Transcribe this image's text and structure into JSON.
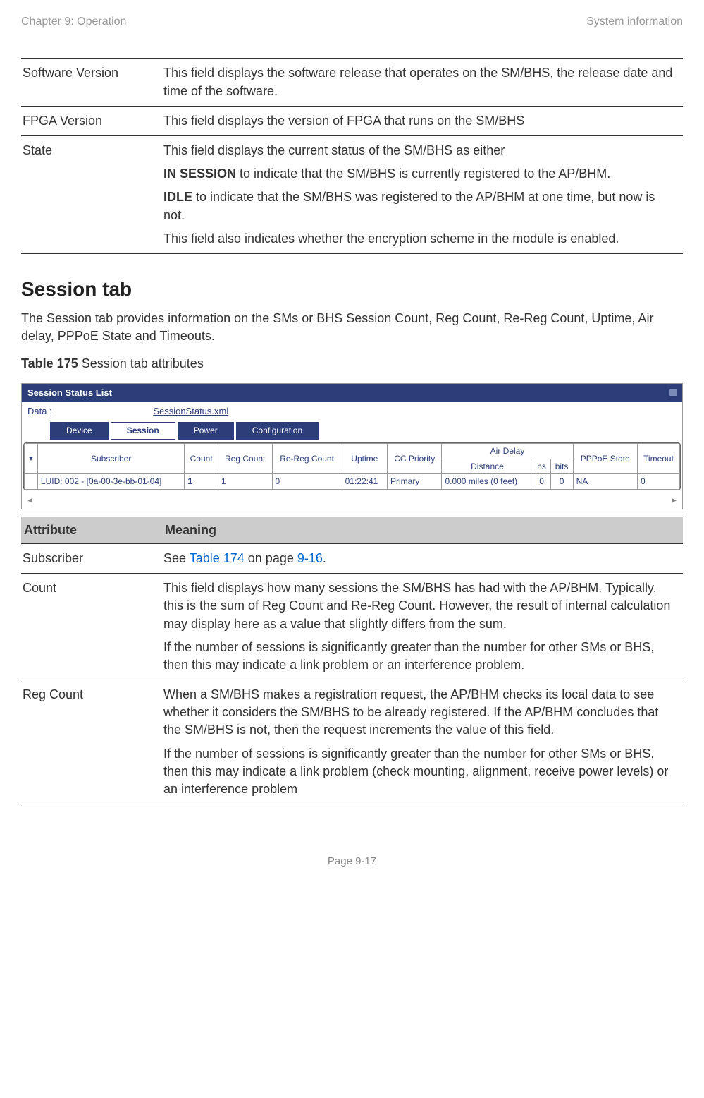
{
  "header": {
    "left": "Chapter 9:  Operation",
    "right": "System information"
  },
  "top_table": [
    {
      "attr": "Software Version",
      "desc": "This field displays the software release that operates on the SM/BHS, the release date and time of the software."
    },
    {
      "attr": "FPGA Version",
      "desc": "This field displays the version of FPGA that runs on the SM/BHS"
    },
    {
      "attr": "State",
      "desc_pre": "This field displays the current status of the SM/BHS as either",
      "in_session": "IN SESSION",
      "in_session_rest": " to indicate that the SM/BHS is currently registered to the AP/BHM.",
      "idle": "IDLE",
      "idle_rest": " to indicate that the SM/BHS was registered to the AP/BHM at one time, but now is not.",
      "last": "This field also indicates whether the encryption scheme in the module is enabled."
    }
  ],
  "h2": "Session tab",
  "h2_para": "The Session tab provides information on the SMs or BHS Session Count, Reg Count, Re-Reg Count, Uptime, Air delay, PPPoE State and Timeouts.",
  "caption": {
    "bold": "Table 175 ",
    "rest": "Session tab attributes"
  },
  "panel": {
    "title": "Session Status List",
    "data_label": "Data :",
    "data_link": "SessionStatus.xml",
    "tabs": [
      "Device",
      "Session",
      "Power",
      "Configuration"
    ],
    "headers": {
      "subscriber": "Subscriber",
      "count": "Count",
      "reg": "Reg Count",
      "rereg": "Re-Reg Count",
      "uptime": "Uptime",
      "cc": "CC Priority",
      "air": "Air Delay",
      "distance": "Distance",
      "ns": "ns",
      "bits": "bits",
      "pppoe": "PPPoE State",
      "timeout": "Timeout"
    },
    "row": {
      "luid_prefix": "LUID: 002 - ",
      "luid_link": "[0a-00-3e-bb-01-04]",
      "count": "1",
      "reg": "1",
      "rereg": "0",
      "uptime": "01:22:41",
      "cc": "Primary",
      "distance": "0.000 miles (0 feet)",
      "ns": "0",
      "bits": "0",
      "pppoe": "NA",
      "timeout": "0"
    }
  },
  "attr_header": {
    "a": "Attribute",
    "b": "Meaning"
  },
  "rows": [
    {
      "attr": "Subscriber",
      "desc_pre": "See ",
      "link1": "Table 174",
      "mid": " on page ",
      "link2": "9-16",
      "post": "."
    },
    {
      "attr": "Count",
      "desc1": "This field displays how many sessions the SM/BHS has had with the AP/BHM. Typically, this is the sum of Reg Count and Re-Reg Count. However, the result of internal calculation may display here as a value that slightly differs from the sum.",
      "desc2": "If the number of sessions is significantly greater than the number for other SMs or BHS, then this may indicate a link problem or an interference problem."
    },
    {
      "attr": "Reg Count",
      "desc1": "When a SM/BHS makes a registration request, the AP/BHM checks its local data to see whether it considers the SM/BHS to be already registered. If the AP/BHM concludes that the SM/BHS is not, then the request increments the value of this field.",
      "desc2": "If the number of sessions is significantly greater than the number for other SMs or BHS, then this may indicate a link problem (check mounting, alignment, receive power levels) or an interference problem"
    }
  ],
  "footer": "Page 9-17"
}
